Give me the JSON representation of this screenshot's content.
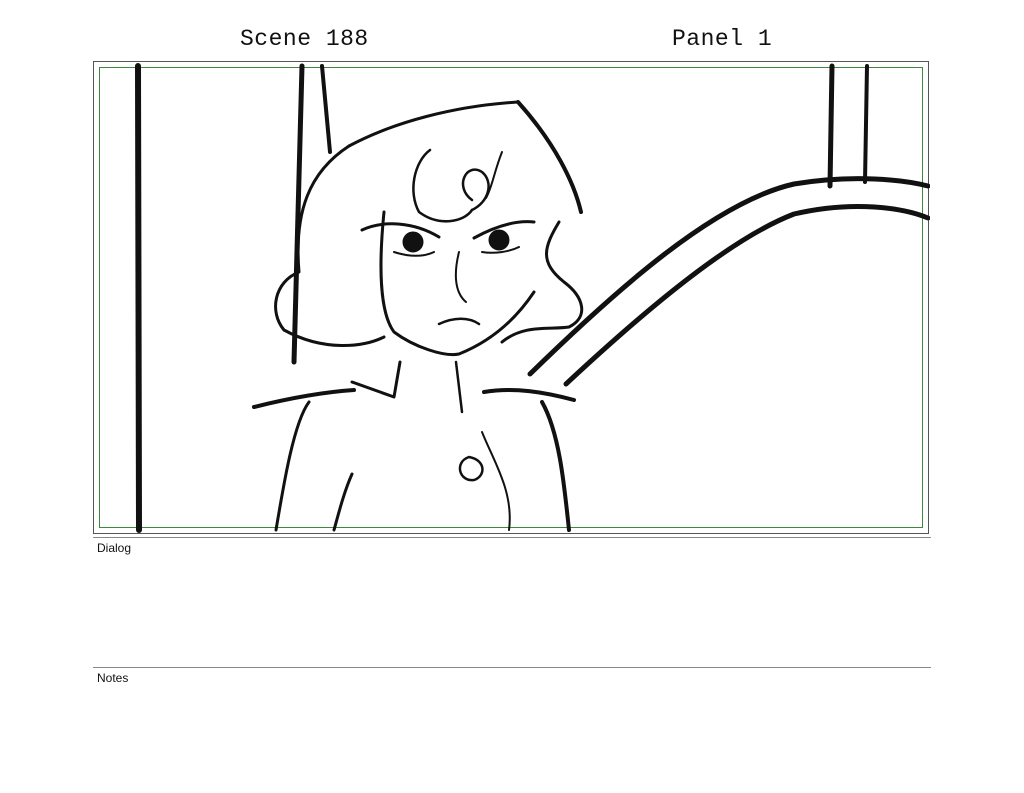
{
  "header": {
    "scene_label": "Scene 188",
    "panel_label": "Panel 1"
  },
  "panel": {
    "safe_area_color": "#3d8a3d",
    "drawing": "storyboard-sketch"
  },
  "dialog": {
    "label": "Dialog",
    "text": ""
  },
  "notes": {
    "label": "Notes",
    "text": ""
  }
}
